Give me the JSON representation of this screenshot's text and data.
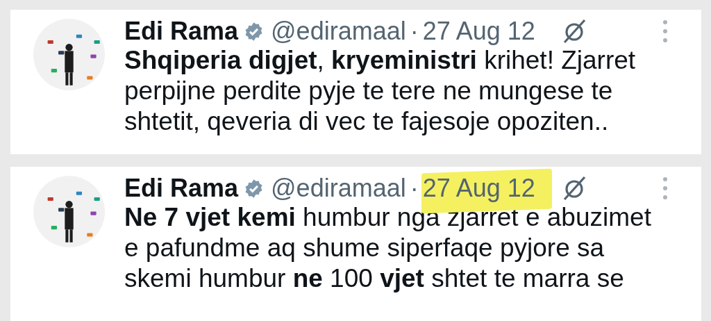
{
  "tweets": [
    {
      "name": "Edi Rama",
      "verified": true,
      "handle": "@ediramaal",
      "separator": "·",
      "date": "27 Aug 12",
      "date_highlighted": false,
      "lines": [
        "**Shqiperia digjet**, **kryeministri** krihet! Zjarret",
        "perpijne perdite pyje te tere ne mungese te",
        "shtetit, qeveria di vec te fajesoje opoziten.."
      ]
    },
    {
      "name": "Edi Rama",
      "verified": true,
      "handle": "@ediramaal",
      "separator": "·",
      "date": "27 Aug 12",
      "date_highlighted": true,
      "lines": [
        "**Ne 7 vjet kemi** humbur nga zjarret e abuzimet",
        "e pafundme aq shume siperfaqe pyjore sa",
        "skemi humbur **ne** 100 **vjet** shtet te marra se"
      ]
    }
  ]
}
